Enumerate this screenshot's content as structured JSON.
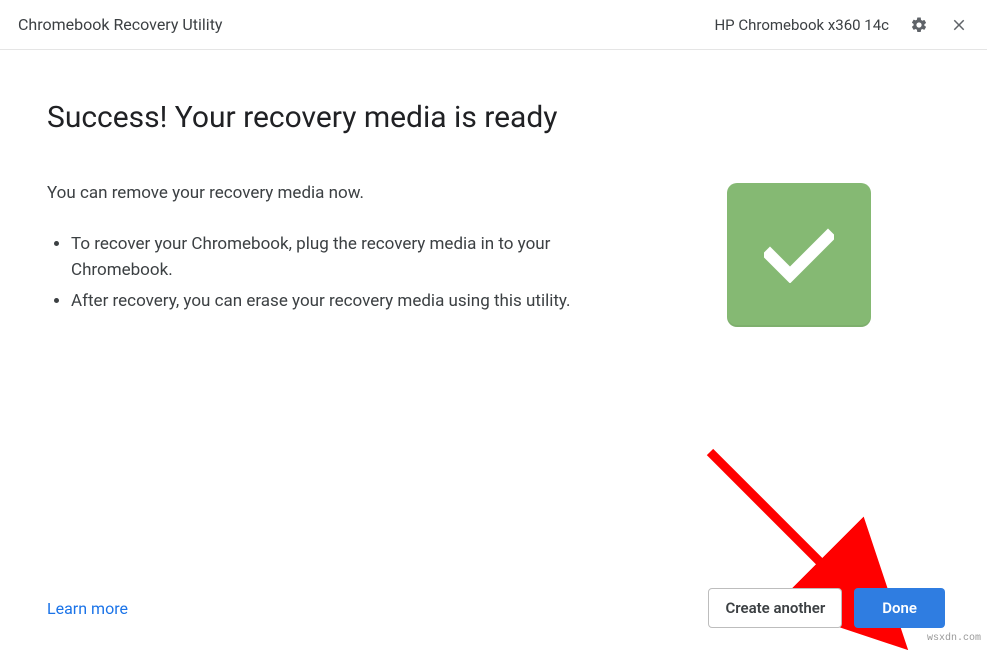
{
  "header": {
    "title": "Chromebook Recovery Utility",
    "device": "HP Chromebook x360 14c"
  },
  "main": {
    "heading": "Success! Your recovery media is ready",
    "intro": "You can remove your recovery media now.",
    "steps": [
      "To recover your Chromebook, plug the recovery media in to your Chromebook.",
      "After recovery, you can erase your recovery media using this utility."
    ]
  },
  "footer": {
    "learn_more": "Learn more",
    "create_another": "Create another",
    "done": "Done"
  },
  "watermark": "wsxdn.com",
  "colors": {
    "success_bg": "#85b973",
    "primary_btn": "#2f7de1",
    "link": "#1a73e8",
    "arrow": "#ff0000"
  }
}
